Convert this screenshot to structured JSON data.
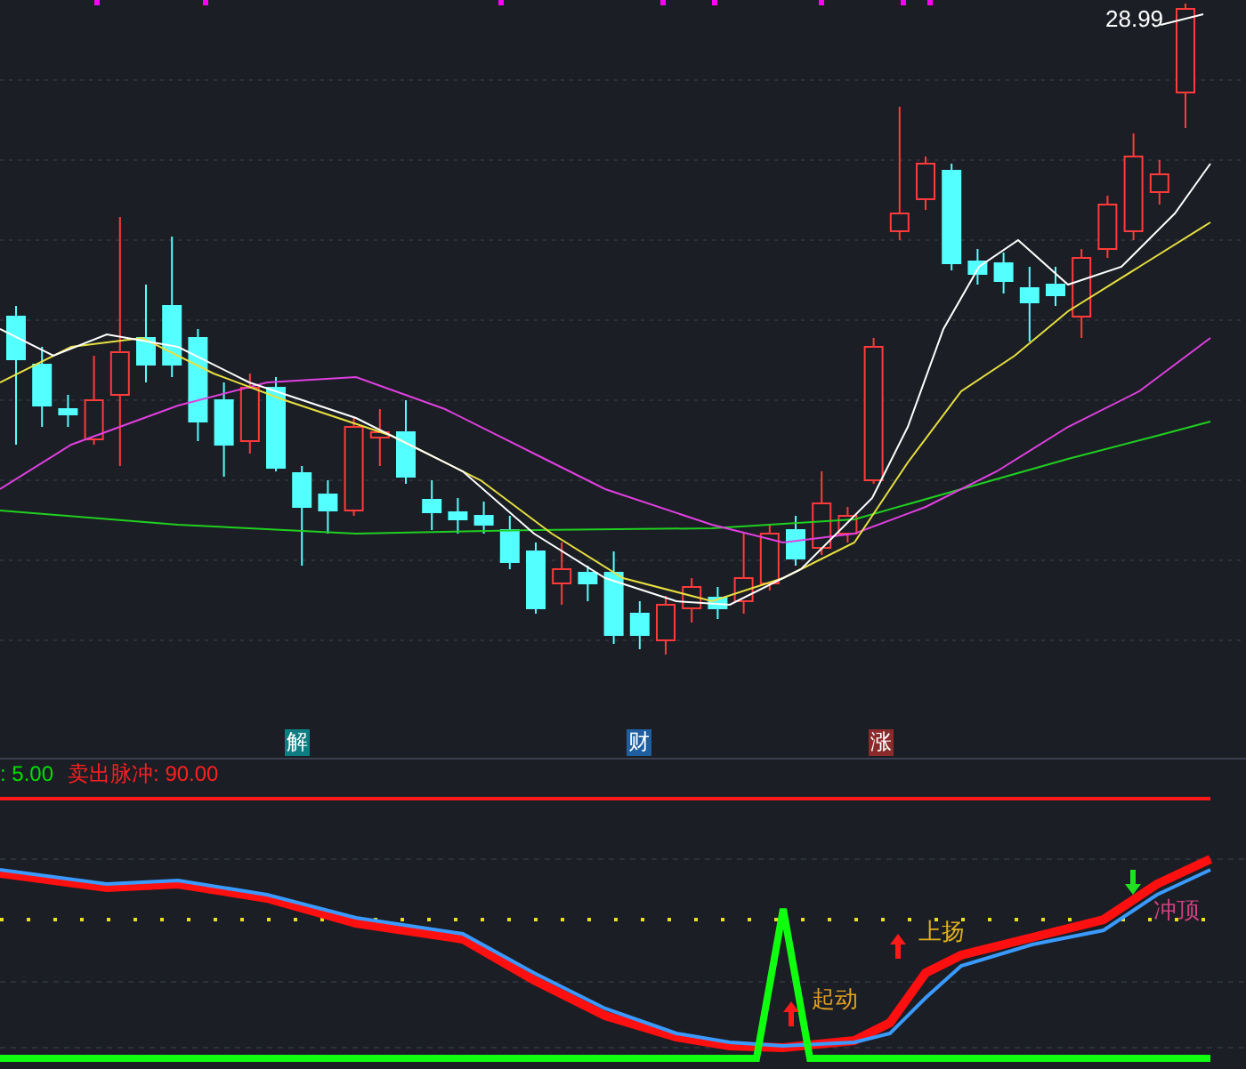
{
  "price_chart": {
    "high_label": "28.99",
    "markers": [
      {
        "text": "解",
        "color": "#0e7c80"
      },
      {
        "text": "财",
        "color": "#1f5fa0"
      },
      {
        "text": "涨",
        "color": "#8a2a2a"
      }
    ]
  },
  "indicator": {
    "legend": [
      {
        "text": ": 5.00",
        "color": "#00e000"
      },
      {
        "text": "卖出脉冲: 90.00",
        "color": "#ff2020"
      }
    ],
    "signals": [
      {
        "text": "起动",
        "kind": "up",
        "color": "#e0a020"
      },
      {
        "text": "上扬",
        "kind": "up",
        "color": "#e0b020"
      },
      {
        "text": "冲顶",
        "kind": "down",
        "color": "#d04080"
      }
    ]
  }
}
